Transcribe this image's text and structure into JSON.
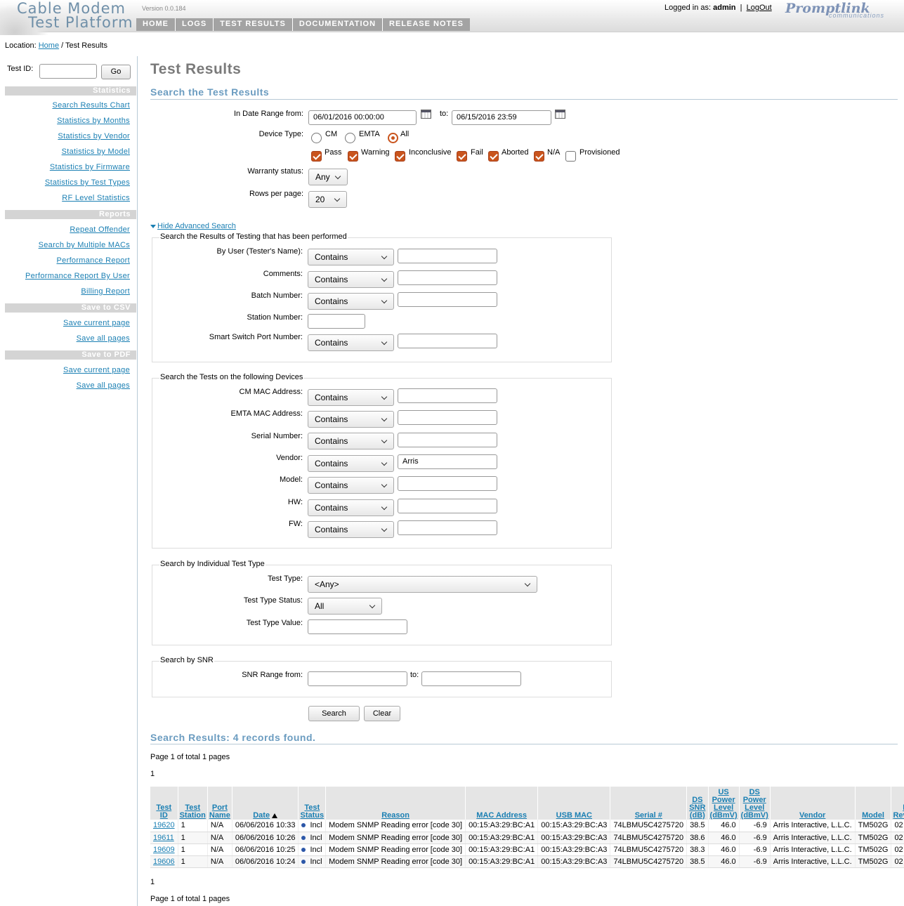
{
  "header": {
    "logo_line1": "Cable Modem",
    "logo_line2": "Test Platform",
    "version": "Version 0.0.184",
    "nav": [
      "HOME",
      "LOGS",
      "TEST RESULTS",
      "DOCUMENTATION",
      "RELEASE NOTES"
    ],
    "logged_in_label": "Logged in as:",
    "user": "admin",
    "separator": "|",
    "logout": "LogOut",
    "brand": "Promptlink",
    "brand_sub": "communications"
  },
  "location": {
    "label": "Location:",
    "home": "Home",
    "sep": "/",
    "current": "Test Results"
  },
  "sidebar": {
    "test_id_label": "Test ID:",
    "go": "Go",
    "statistics_head": "Statistics",
    "statistics": [
      "Search Results Chart",
      "Statistics by Months",
      "Statistics by Vendor",
      "Statistics by Model",
      "Statistics by Firmware",
      "Statistics by Test Types",
      "RF Level Statistics"
    ],
    "reports_head": "Reports",
    "reports": [
      "Repeat Offender",
      "Search by Multiple MACs",
      "Performance Report",
      "Performance Report By User",
      "Billing Report"
    ],
    "csv_head": "Save to CSV",
    "csv": [
      "Save current page",
      "Save all pages"
    ],
    "pdf_head": "Save to PDF",
    "pdf": [
      "Save current page",
      "Save all pages"
    ]
  },
  "main": {
    "title": "Test Results",
    "search_title": "Search the Test Results",
    "date_label": "In Date Range from:",
    "date_from": "06/01/2016 00:00:00",
    "date_to_label": "to:",
    "date_to": "06/15/2016 23:59",
    "device_type_label": "Device Type:",
    "device_types": [
      "CM",
      "EMTA",
      "All"
    ],
    "statuses": [
      "Pass",
      "Warning",
      "Inconclusive",
      "Fail",
      "Aborted",
      "N/A",
      "Provisioned"
    ],
    "warranty_label": "Warranty status:",
    "warranty_value": "Any",
    "rows_label": "Rows per page:",
    "rows_value": "20",
    "adv_toggle": "Hide Advanced Search",
    "fs1_legend": "Search the Results of Testing that has been performed",
    "fs1": {
      "user": "By User (Tester's Name):",
      "comments": "Comments:",
      "batch": "Batch Number:",
      "station": "Station Number:",
      "port": "Smart Switch Port Number:"
    },
    "contains": "Contains",
    "fs2_legend": "Search the Tests on the following Devices",
    "fs2": {
      "cm_mac": "CM MAC Address:",
      "emta_mac": "EMTA MAC Address:",
      "serial": "Serial Number:",
      "vendor": "Vendor:",
      "vendor_value": "Arris",
      "model": "Model:",
      "hw": "HW:",
      "fw": "FW:"
    },
    "fs3_legend": "Search by Individual Test Type",
    "fs3": {
      "test_type": "Test Type:",
      "test_type_value": "<Any>",
      "status": "Test Type Status:",
      "status_value": "All",
      "value": "Test Type Value:"
    },
    "fs4_legend": "Search by SNR",
    "fs4": {
      "from": "SNR Range from:",
      "to": "to:"
    },
    "search_btn": "Search",
    "clear_btn": "Clear",
    "results_title": "Search Results: 4 records found.",
    "pages_text": "Page 1 of total 1 pages",
    "page_num": "1"
  },
  "table": {
    "headers": [
      "Test ID",
      "Test Station",
      "Port Name",
      "Date",
      "Test Status",
      "Reason",
      "MAC Address",
      "USB MAC",
      "Serial #",
      "DS SNR (dB)",
      "US Power Level (dBmV)",
      "DS Power Level (dBmV)",
      "Vendor",
      "Model",
      "HW Revision"
    ],
    "rows": [
      [
        "19620",
        "1",
        "N/A",
        "06/06/2016 10:33",
        "Incl",
        "Modem SNMP Reading error [code 30]",
        "00:15:A3:29:BC:A1",
        "00:15:A3:29:BC:A3",
        "74LBMU5C4275720",
        "38.5",
        "46.0",
        "-6.9",
        "Arris Interactive, L.L.C.",
        "TM502G",
        "02"
      ],
      [
        "19611",
        "1",
        "N/A",
        "06/06/2016 10:26",
        "Incl",
        "Modem SNMP Reading error [code 30]",
        "00:15:A3:29:BC:A1",
        "00:15:A3:29:BC:A3",
        "74LBMU5C4275720",
        "38.6",
        "46.0",
        "-6.9",
        "Arris Interactive, L.L.C.",
        "TM502G",
        "02"
      ],
      [
        "19609",
        "1",
        "N/A",
        "06/06/2016 10:25",
        "Incl",
        "Modem SNMP Reading error [code 30]",
        "00:15:A3:29:BC:A1",
        "00:15:A3:29:BC:A3",
        "74LBMU5C4275720",
        "38.3",
        "46.0",
        "-6.9",
        "Arris Interactive, L.L.C.",
        "TM502G",
        "02"
      ],
      [
        "19606",
        "1",
        "N/A",
        "06/06/2016 10:24",
        "Incl",
        "Modem SNMP Reading error [code 30]",
        "00:15:A3:29:BC:A1",
        "00:15:A3:29:BC:A3",
        "74LBMU5C4275720",
        "38.5",
        "46.0",
        "-6.9",
        "Arris Interactive, L.L.C.",
        "TM502G",
        "02"
      ]
    ]
  },
  "colors": {
    "accent": "#c9541d",
    "link": "#1a7fb3",
    "section": "#6b9cc0",
    "nav_bg": "#a3a3a3"
  }
}
